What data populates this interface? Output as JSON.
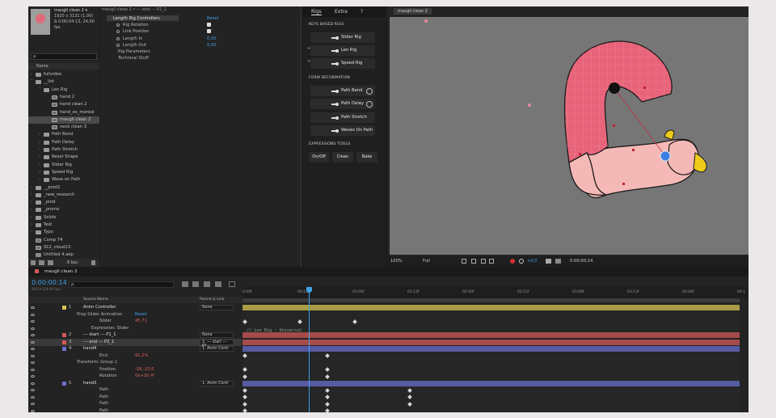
{
  "project": {
    "comp_name": "maugli clean 2 ▾",
    "comp_size": "1920 x 3131 (1,00)",
    "comp_dur": "Δ 0:00:04:13, 24,00 fps",
    "search_placeholder": "ρ.",
    "col_name": "Name",
    "bpc": "8 bpc",
    "items": [
      {
        "label": "fullvideo",
        "type": "folder",
        "indent": 0,
        "tw": "›"
      },
      {
        "label": "__list",
        "type": "folder",
        "indent": 0,
        "tw": "˅"
      },
      {
        "label": "Len Rig",
        "type": "folder",
        "indent": 1,
        "tw": "˅"
      },
      {
        "label": "hand 2",
        "type": "comp",
        "indent": 2,
        "tw": ""
      },
      {
        "label": "hand clean 2",
        "type": "comp",
        "indent": 2,
        "tw": ""
      },
      {
        "label": "hand_ex_mental",
        "type": "comp",
        "indent": 2,
        "tw": ""
      },
      {
        "label": "maugli clean 2",
        "type": "comp",
        "indent": 2,
        "tw": "",
        "sel": true
      },
      {
        "label": "neck clean 3",
        "type": "comp",
        "indent": 2,
        "tw": ""
      },
      {
        "label": "Path Bend",
        "type": "folder",
        "indent": 1,
        "tw": "›"
      },
      {
        "label": "Path Delay",
        "type": "folder",
        "indent": 1,
        "tw": "›"
      },
      {
        "label": "Path Stretch",
        "type": "folder",
        "indent": 1,
        "tw": "›"
      },
      {
        "label": "Reset Shape",
        "type": "folder",
        "indent": 1,
        "tw": "›"
      },
      {
        "label": "Slider Rig",
        "type": "folder",
        "indent": 1,
        "tw": "›"
      },
      {
        "label": "Speed Rig",
        "type": "folder",
        "indent": 1,
        "tw": "›"
      },
      {
        "label": "Wave on Path",
        "type": "folder",
        "indent": 1,
        "tw": "›"
      },
      {
        "label": "__prod2",
        "type": "folder",
        "indent": 0,
        "tw": "›"
      },
      {
        "label": "_new_research",
        "type": "folder",
        "indent": 0,
        "tw": "›"
      },
      {
        "label": "_prod",
        "type": "folder",
        "indent": 0,
        "tw": "›"
      },
      {
        "label": "_promo",
        "type": "folder",
        "indent": 0,
        "tw": "›"
      },
      {
        "label": "Solids",
        "type": "folder",
        "indent": 0,
        "tw": "›"
      },
      {
        "label": "Test",
        "type": "folder",
        "indent": 0,
        "tw": "›"
      },
      {
        "label": "Typo",
        "type": "folder",
        "indent": 0,
        "tw": "›"
      },
      {
        "label": "Comp 74",
        "type": "comp",
        "indent": 0,
        "tw": ""
      },
      {
        "label": "912_cloud13",
        "type": "comp",
        "indent": 0,
        "tw": ""
      },
      {
        "label": "Untitled 4.aep",
        "type": "file",
        "indent": 0,
        "tw": ""
      }
    ]
  },
  "effect_controls": {
    "tab": "maugli clean 2 • --- end --- P2_1",
    "rows": [
      {
        "label": "Length Rig Controllers",
        "kind": "group",
        "value": "Reset"
      },
      {
        "label": "Rig Rotation",
        "kind": "check"
      },
      {
        "label": "Link Position",
        "kind": "check"
      },
      {
        "label": "Length In",
        "kind": "value",
        "value": "0,00"
      },
      {
        "label": "Length Out",
        "kind": "value",
        "value": "0,00"
      },
      {
        "label": "Rig Parameters",
        "kind": "sub"
      },
      {
        "label": "Technical Stuff",
        "kind": "sub"
      }
    ]
  },
  "rig_panel": {
    "tabs": [
      "Rigs",
      "Extra",
      "?"
    ],
    "section1": "KEYS BASED RIGS",
    "keys_rigs": [
      "Slider Rig",
      "Len Rig",
      "Speed Rig"
    ],
    "section2": "FORM DEFORMATION",
    "form_rigs": [
      "Path Bend",
      "Path Delay",
      "Path Stretch",
      "Waves On Path"
    ],
    "section3": "EXPRESSIONS TOOLS",
    "tools": [
      "On/Off",
      "Clean",
      "Bake"
    ]
  },
  "comp_viewer": {
    "tab": "maugli clean 2",
    "zoom": "100%",
    "resolution": "Full",
    "exposure": "+0,0",
    "timecode": "0:00:00:14",
    "colors": {
      "arm_pink": "#e8647a",
      "arm_skin": "#f3b8b5",
      "yellow": "#f0cb1a",
      "bg": "#767676"
    }
  },
  "timeline": {
    "tab": "maugli clean 2",
    "current_time": "0:00:00:14",
    "fps_text": "00014 (24.00 fps)",
    "search_placeholder": "ρ.",
    "col_source": "Source Name",
    "col_parent": "Parent & Link",
    "ruler": [
      "0:00f",
      "00:12f",
      "01:00f",
      "01:12f",
      "02:00f",
      "02:12f",
      "03:00f",
      "03:12f",
      "04:00f",
      "04:1"
    ],
    "expression_text": "// Len Rig - Universal",
    "layers": [
      {
        "num": "1",
        "name": "Anim Controller",
        "kind": "layer",
        "color": "#d6c552",
        "parent": "None"
      },
      {
        "num": "",
        "name": "Prop Slider Animation",
        "kind": "group",
        "value": "Reset"
      },
      {
        "num": "",
        "name": "Slider",
        "kind": "prop",
        "value": "45,71"
      },
      {
        "num": "",
        "name": "Expression: Slider",
        "kind": "expr"
      },
      {
        "num": "2",
        "name": "--- start --- P1_1",
        "kind": "layer",
        "color": "#d25a5a",
        "parent": "None"
      },
      {
        "num": "3",
        "name": "--- end --- P2_1",
        "kind": "layer",
        "color": "#d25a5a",
        "parent": "2. --- start --- P1"
      },
      {
        "num": "4",
        "name": "hand4",
        "kind": "layer",
        "color": "#6a6fd0",
        "parent": "1. Anim Contr"
      },
      {
        "num": "",
        "name": "End",
        "kind": "prop",
        "value": "91,2%"
      },
      {
        "num": "",
        "name": "Transform: Group 1",
        "kind": "group",
        "value": ""
      },
      {
        "num": "",
        "name": "Position",
        "kind": "prop",
        "value": "-18,-23,0"
      },
      {
        "num": "",
        "name": "Rotation",
        "kind": "prop",
        "value": "0x+20,4°"
      },
      {
        "num": "5",
        "name": "hand3",
        "kind": "layer",
        "color": "#6a6fd0",
        "parent": "1. Anim Contr"
      },
      {
        "num": "",
        "name": "Path",
        "kind": "prop",
        "value": ""
      },
      {
        "num": "",
        "name": "Path",
        "kind": "prop",
        "value": ""
      },
      {
        "num": "",
        "name": "Path",
        "kind": "prop",
        "value": ""
      },
      {
        "num": "",
        "name": "Path",
        "kind": "prop",
        "value": ""
      }
    ]
  }
}
